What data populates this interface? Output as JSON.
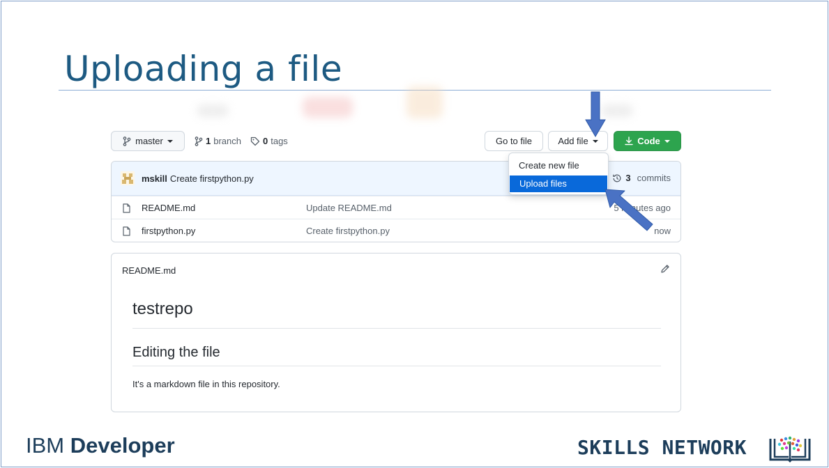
{
  "slide": {
    "title": "Uploading a file"
  },
  "toolbar": {
    "branch_label": "master",
    "branch_count": "1",
    "branch_text": "branch",
    "tag_count": "0",
    "tag_text": "tags",
    "goto_file_label": "Go to file",
    "add_file_label": "Add file",
    "code_label": "Code"
  },
  "add_file_menu": {
    "items": [
      "Create new file",
      "Upload files"
    ],
    "selected": "Upload files"
  },
  "latest_commit": {
    "author": "mskill",
    "message": "Create firstpython.py",
    "commit_count": "3",
    "commit_text": "commits"
  },
  "files": [
    {
      "name": "README.md",
      "message": "Update README.md",
      "age": "5 minutes ago"
    },
    {
      "name": "firstpython.py",
      "message": "Create firstpython.py",
      "age": "now"
    }
  ],
  "readme": {
    "header": "README.md",
    "h1": "testrepo",
    "h2": "Editing the file",
    "paragraph": "It's a markdown file in this repository."
  },
  "branding": {
    "ibm_light": "IBM",
    "ibm_bold": "Developer",
    "skills_network": "SKILLS NETWORK"
  },
  "colors": {
    "title": "#1d5a82",
    "code_button": "#2da44e",
    "selected_item": "#0969da",
    "arrow": "#4a72c4"
  },
  "icons": {
    "branch": "git-branch-icon",
    "tag": "tag-icon",
    "download": "download-icon",
    "history": "history-icon",
    "file": "file-icon",
    "pencil": "pencil-icon"
  }
}
